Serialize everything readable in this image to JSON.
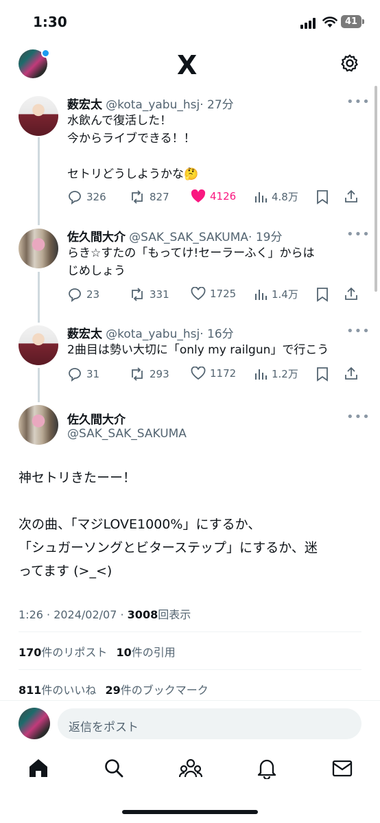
{
  "status_bar": {
    "time": "1:30",
    "battery": "41"
  },
  "header": {
    "logo": "X",
    "settings_icon": "gear-icon"
  },
  "thread": [
    {
      "display_name": "薮宏太",
      "handle": "@kota_yabu_hsj",
      "time": "· 27分",
      "text": "水飲んで復活した！\n今からライブできる！！\n\nセトリどうしようかな🤔",
      "replies": "326",
      "reposts": "827",
      "likes": "4126",
      "views": "4.8万"
    },
    {
      "display_name": "佐久間大介",
      "handle": "@SAK_SAK_SAKUMA",
      "time": "· 19分",
      "text": "らき☆すたの「もってけ!セーラーふく」からは\nじめしょう",
      "replies": "23",
      "reposts": "331",
      "likes": "1725",
      "views": "1.4万"
    },
    {
      "display_name": "薮宏太",
      "handle": "@kota_yabu_hsj",
      "time": "· 16分",
      "text": "2曲目は勢い大切に「only my railgun」で行こう",
      "replies": "31",
      "reposts": "293",
      "likes": "1172",
      "views": "1.2万"
    }
  ],
  "main_tweet": {
    "display_name": "佐久間大介",
    "handle": "@SAK_SAK_SAKUMA",
    "text": "神セトリきたーー！\n\n次の曲、「マジLOVE1000%」にするか、\n「シュガーソングとビターステップ」にするか、迷\nってます (>_<)",
    "timestamp": "1:26 · 2024/02/07 · ",
    "views_count": "3008",
    "views_label": "回表示",
    "reposts_count": "170",
    "reposts_label": "件のリポスト",
    "quotes_count": "10",
    "quotes_label": "件の引用",
    "likes_count": "811",
    "likes_label": "件のいいね",
    "bookmarks_count": "29",
    "bookmarks_label": "件のブックマーク"
  },
  "reply_box": {
    "placeholder": "返信をポスト"
  },
  "more_glyph": "•••",
  "colors": {
    "like": "#f91880",
    "accent": "#1d9bf0",
    "text": "#0f1419",
    "muted": "#536471"
  }
}
